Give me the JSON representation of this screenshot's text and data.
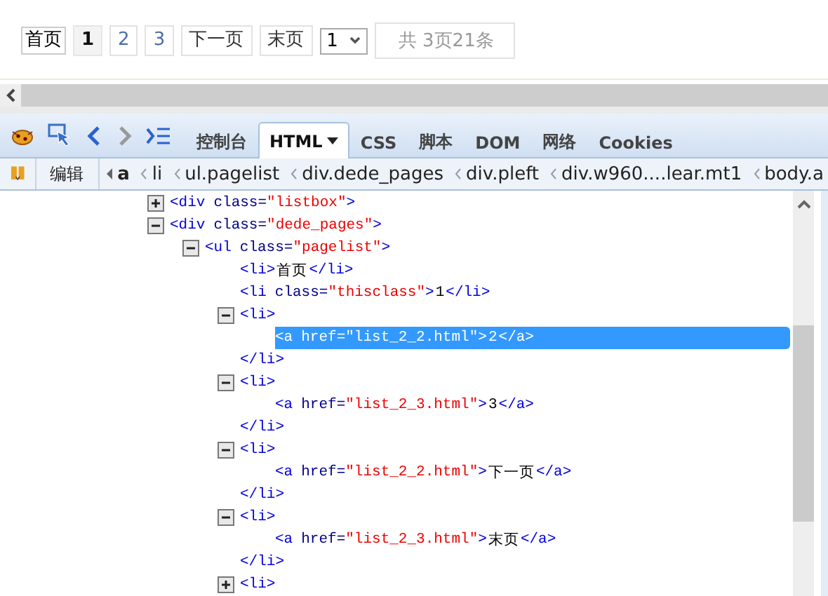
{
  "pagination": [
    {
      "kind": "link",
      "label": "首页"
    },
    {
      "kind": "page",
      "label": "1",
      "selected": true
    },
    {
      "kind": "page",
      "label": "2",
      "selected": false
    },
    {
      "kind": "page",
      "label": "3",
      "selected": false
    },
    {
      "kind": "link",
      "label": "下一页"
    },
    {
      "kind": "link",
      "label": "末页"
    },
    {
      "kind": "select",
      "label": "1"
    },
    {
      "kind": "info",
      "label": "共 3页21条"
    }
  ],
  "toolbar": {
    "tabs": [
      {
        "label": "控制台",
        "selected": false,
        "menu": false
      },
      {
        "label": "HTML",
        "selected": true,
        "menu": true
      },
      {
        "label": "CSS",
        "selected": false,
        "menu": false
      },
      {
        "label": "脚本",
        "selected": false,
        "menu": false
      },
      {
        "label": "DOM",
        "selected": false,
        "menu": false
      },
      {
        "label": "网络",
        "selected": false,
        "menu": false
      },
      {
        "label": "Cookies",
        "selected": false,
        "menu": false
      }
    ]
  },
  "breadcrumb": {
    "edit_button": "编辑",
    "items": [
      {
        "label": "a",
        "selected": true
      },
      {
        "label": "li",
        "selected": false
      },
      {
        "label": "ul.pagelist",
        "selected": false
      },
      {
        "label": "div.dede_pages",
        "selected": false
      },
      {
        "label": "div.pleft",
        "selected": false
      },
      {
        "label": "div.w960....lear.mt1",
        "selected": false
      },
      {
        "label": "body.a",
        "selected": false
      }
    ]
  },
  "tree": [
    {
      "expanded": false,
      "selected": false,
      "open": [
        {
          "kind": "tag",
          "text": "<div"
        },
        {
          "kind": "attr",
          "text": "class="
        },
        {
          "kind": "value",
          "text": "\"listbox\""
        },
        {
          "kind": "tag",
          "text": ">"
        }
      ]
    },
    {
      "expanded": true,
      "selected": false,
      "open": [
        {
          "kind": "tag",
          "text": "<div"
        },
        {
          "kind": "attr",
          "text": "class="
        },
        {
          "kind": "value",
          "text": "\"dede_pages\""
        },
        {
          "kind": "tag",
          "text": ">"
        }
      ],
      "children": [
        {
          "expanded": true,
          "selected": false,
          "open": [
            {
              "kind": "tag",
              "text": "<ul"
            },
            {
              "kind": "attr",
              "text": "class="
            },
            {
              "kind": "value",
              "text": "\"pagelist\""
            },
            {
              "kind": "tag",
              "text": ">"
            }
          ],
          "children": [
            {
              "selected": false,
              "open": [
                {
                  "kind": "tag",
                  "text": "<li>"
                },
                {
                  "kind": "text",
                  "text": "首页"
                },
                {
                  "kind": "tag",
                  "text": "</li>"
                }
              ]
            },
            {
              "selected": false,
              "open": [
                {
                  "kind": "tag",
                  "text": "<li"
                },
                {
                  "kind": "attr",
                  "text": "class="
                },
                {
                  "kind": "value",
                  "text": "\"thisclass\""
                },
                {
                  "kind": "tag",
                  "text": ">"
                },
                {
                  "kind": "text",
                  "text": "1"
                },
                {
                  "kind": "tag",
                  "text": "</li>"
                }
              ]
            },
            {
              "expanded": true,
              "selected": false,
              "open": [
                {
                  "kind": "tag",
                  "text": "<li>"
                }
              ],
              "close": [
                {
                  "kind": "tag",
                  "text": "</li>"
                }
              ],
              "children": [
                {
                  "selected": true,
                  "open": [
                    {
                      "kind": "tag",
                      "text": "<a"
                    },
                    {
                      "kind": "attr",
                      "text": "href="
                    },
                    {
                      "kind": "value",
                      "text": "\"list_2_2.html\""
                    },
                    {
                      "kind": "tag",
                      "text": ">"
                    },
                    {
                      "kind": "text",
                      "text": "2"
                    },
                    {
                      "kind": "tag",
                      "text": "</a>"
                    }
                  ]
                }
              ]
            },
            {
              "expanded": true,
              "selected": false,
              "open": [
                {
                  "kind": "tag",
                  "text": "<li>"
                }
              ],
              "close": [
                {
                  "kind": "tag",
                  "text": "</li>"
                }
              ],
              "children": [
                {
                  "selected": false,
                  "open": [
                    {
                      "kind": "tag",
                      "text": "<a"
                    },
                    {
                      "kind": "attr",
                      "text": "href="
                    },
                    {
                      "kind": "value",
                      "text": "\"list_2_3.html\""
                    },
                    {
                      "kind": "tag",
                      "text": ">"
                    },
                    {
                      "kind": "text",
                      "text": "3"
                    },
                    {
                      "kind": "tag",
                      "text": "</a>"
                    }
                  ]
                }
              ]
            },
            {
              "expanded": true,
              "selected": false,
              "open": [
                {
                  "kind": "tag",
                  "text": "<li>"
                }
              ],
              "close": [
                {
                  "kind": "tag",
                  "text": "</li>"
                }
              ],
              "children": [
                {
                  "selected": false,
                  "open": [
                    {
                      "kind": "tag",
                      "text": "<a"
                    },
                    {
                      "kind": "attr",
                      "text": "href="
                    },
                    {
                      "kind": "value",
                      "text": "\"list_2_2.html\""
                    },
                    {
                      "kind": "tag",
                      "text": ">"
                    },
                    {
                      "kind": "text",
                      "text": "下一页"
                    },
                    {
                      "kind": "tag",
                      "text": "</a>"
                    }
                  ]
                }
              ]
            },
            {
              "expanded": true,
              "selected": false,
              "open": [
                {
                  "kind": "tag",
                  "text": "<li>"
                }
              ],
              "close": [
                {
                  "kind": "tag",
                  "text": "</li>"
                }
              ],
              "children": [
                {
                  "selected": false,
                  "open": [
                    {
                      "kind": "tag",
                      "text": "<a"
                    },
                    {
                      "kind": "attr",
                      "text": "href="
                    },
                    {
                      "kind": "value",
                      "text": "\"list_2_3.html\""
                    },
                    {
                      "kind": "tag",
                      "text": ">"
                    },
                    {
                      "kind": "text",
                      "text": "末页"
                    },
                    {
                      "kind": "tag",
                      "text": "</a>"
                    }
                  ]
                }
              ]
            },
            {
              "expanded": false,
              "selected": false,
              "open": [
                {
                  "kind": "tag",
                  "text": "<li>"
                }
              ]
            }
          ]
        }
      ]
    }
  ]
}
